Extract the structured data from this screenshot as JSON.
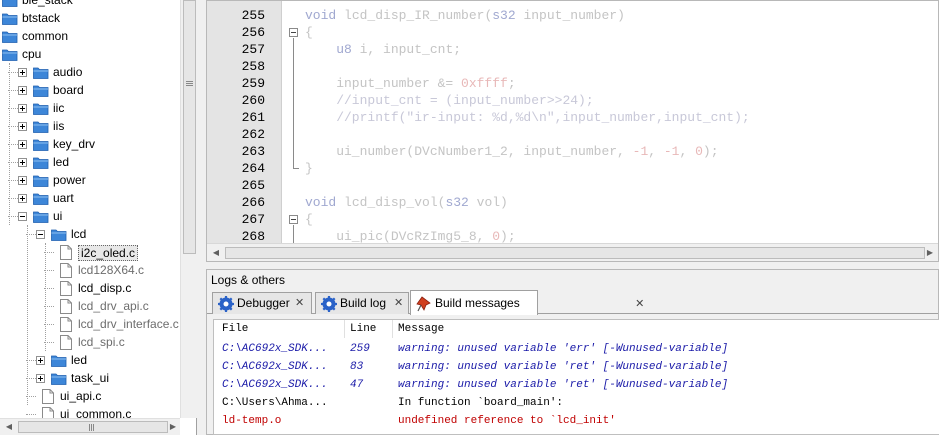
{
  "tree": {
    "items": [
      {
        "label": "ble_stack",
        "type": "folder",
        "indent": 0
      },
      {
        "label": "btstack",
        "type": "folder",
        "indent": 0
      },
      {
        "label": "common",
        "type": "folder",
        "indent": 0
      },
      {
        "label": "cpu",
        "type": "folder",
        "indent": 0
      },
      {
        "label": "audio",
        "type": "folder",
        "indent": 1,
        "expander": "plus"
      },
      {
        "label": "board",
        "type": "folder",
        "indent": 1,
        "expander": "plus"
      },
      {
        "label": "iic",
        "type": "folder",
        "indent": 1,
        "expander": "plus"
      },
      {
        "label": "iis",
        "type": "folder",
        "indent": 1,
        "expander": "plus"
      },
      {
        "label": "key_drv",
        "type": "folder",
        "indent": 1,
        "expander": "plus"
      },
      {
        "label": "led",
        "type": "folder",
        "indent": 1,
        "expander": "plus"
      },
      {
        "label": "power",
        "type": "folder",
        "indent": 1,
        "expander": "plus"
      },
      {
        "label": "uart",
        "type": "folder",
        "indent": 1,
        "expander": "plus"
      },
      {
        "label": "ui",
        "type": "folder",
        "indent": 1,
        "expander": "minus"
      },
      {
        "label": "lcd",
        "type": "folder",
        "indent": 2,
        "expander": "minus"
      },
      {
        "label": "i2c_oled.c",
        "type": "file",
        "indent": 3,
        "selected": true
      },
      {
        "label": "lcd128X64.c",
        "type": "file",
        "indent": 3,
        "gray": true
      },
      {
        "label": "lcd_disp.c",
        "type": "file",
        "indent": 3
      },
      {
        "label": "lcd_drv_api.c",
        "type": "file",
        "indent": 3,
        "gray": true
      },
      {
        "label": "lcd_drv_interface.c",
        "type": "file",
        "indent": 3,
        "gray": true
      },
      {
        "label": "lcd_spi.c",
        "type": "file",
        "indent": 3,
        "gray": true
      },
      {
        "label": "led",
        "type": "folder",
        "indent": 2,
        "expander": "plus"
      },
      {
        "label": "task_ui",
        "type": "folder",
        "indent": 2,
        "expander": "plus"
      },
      {
        "label": "ui_api.c",
        "type": "file",
        "indent": 2
      },
      {
        "label": "ui_common.c",
        "type": "file",
        "indent": 2
      }
    ]
  },
  "editor": {
    "lines": [
      {
        "num": "255",
        "code": "void lcd_disp_IR_number(s32 input_number)"
      },
      {
        "num": "256",
        "code": "{"
      },
      {
        "num": "257",
        "code": "    u8 i, input_cnt;"
      },
      {
        "num": "258",
        "code": ""
      },
      {
        "num": "259",
        "code": "    input_number &= 0xffff;"
      },
      {
        "num": "260",
        "code": "    //input_cnt = (input_number>>24);"
      },
      {
        "num": "261",
        "code": "    //printf(\"ir-input: %d,%d\\n\",input_number,input_cnt);"
      },
      {
        "num": "262",
        "code": ""
      },
      {
        "num": "263",
        "code": "    ui_number(DVcNumber1_2, input_number, -1, -1, 0);"
      },
      {
        "num": "264",
        "code": "}"
      },
      {
        "num": "265",
        "code": ""
      },
      {
        "num": "266",
        "code": "void lcd_disp_vol(s32 vol)"
      },
      {
        "num": "267",
        "code": "{"
      },
      {
        "num": "268",
        "code": "    ui_pic(DVcRzImg5_8, 0);"
      }
    ]
  },
  "logs": {
    "title": "Logs & others",
    "tabs": [
      {
        "label": "Debugger",
        "close": "✕"
      },
      {
        "label": "Build log",
        "close": "✕"
      },
      {
        "label": "Build messages",
        "close": "✕"
      }
    ],
    "columns": [
      "File",
      "Line",
      "Message"
    ],
    "rows": [
      {
        "file": "C:\\AC692x_SDK...",
        "line": "259",
        "message": "warning: unused variable 'err' [-Wunused-variable]",
        "kind": "warn"
      },
      {
        "file": "C:\\AC692x_SDK...",
        "line": "83",
        "message": "warning: unused variable 'ret' [-Wunused-variable]",
        "kind": "warn"
      },
      {
        "file": "C:\\AC692x_SDK...",
        "line": "47",
        "message": "warning: unused variable 'ret' [-Wunused-variable]",
        "kind": "warn"
      },
      {
        "file": "C:\\Users\\Ahma...",
        "line": "",
        "message": "In function `board_main':",
        "kind": "info"
      },
      {
        "file": "ld-temp.o",
        "line": "",
        "message": " undefined reference to `lcd_init'",
        "kind": "err"
      }
    ]
  },
  "colors": {
    "folder": "#3d86d8",
    "warning_text": "#1a1aa8",
    "error_text": "#c00000"
  },
  "icons": {
    "folder": "folder-icon",
    "file": "file-icon",
    "debugger_tab": "gear-icon",
    "buildlog_tab": "gear-icon",
    "buildmsg_tab": "pin-icon"
  }
}
